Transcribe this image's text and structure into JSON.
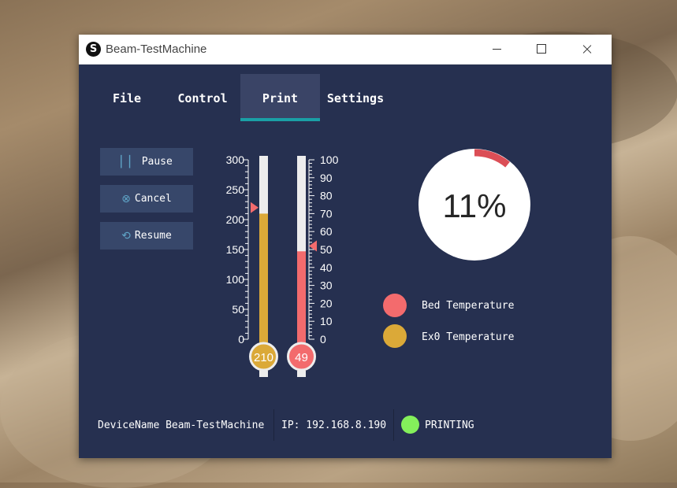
{
  "window": {
    "title": "Beam-TestMachine",
    "logo_glyph": "S"
  },
  "tabs": [
    {
      "label": "File",
      "active": false
    },
    {
      "label": "Control",
      "active": false
    },
    {
      "label": "Print",
      "active": true
    },
    {
      "label": "Settings",
      "active": false
    }
  ],
  "controls": [
    {
      "label": "Pause",
      "icon": "pause-icon"
    },
    {
      "label": "Cancel",
      "icon": "cancel-icon"
    },
    {
      "label": "Resume",
      "icon": "resume-icon"
    }
  ],
  "thermometers": [
    {
      "name": "ex0-temperature",
      "min": 0,
      "max": 300,
      "ticks": [
        "0",
        "50",
        "100",
        "150",
        "200",
        "250",
        "300"
      ],
      "fill_value": 210,
      "target_value": 220,
      "reading": "210",
      "color": "#dba938"
    },
    {
      "name": "bed-temperature",
      "min": 0,
      "max": 100,
      "ticks": [
        "0",
        "10",
        "20",
        "30",
        "40",
        "50",
        "60",
        "70",
        "80",
        "90",
        "100"
      ],
      "fill_value": 49,
      "target_value": 52,
      "reading": "49",
      "color": "#f36b6d"
    }
  ],
  "progress": {
    "label": "11%",
    "fraction": 0.11,
    "color": "#db4e56"
  },
  "legend": [
    {
      "label": "Bed Temperature",
      "color": "#f36b6d"
    },
    {
      "label": "Ex0 Temperature",
      "color": "#dba938"
    }
  ],
  "status": {
    "device": "DeviceName Beam-TestMachine",
    "ip": "IP: 192.168.8.190",
    "state": "PRINTING",
    "state_color": "#84ef5b"
  },
  "colors": {
    "window_bg": "#263050",
    "tab_active_bg": "#3a4466",
    "tab_indicator": "#1aa0a6",
    "button_bg": "#37476a",
    "marker": "#f36b6d"
  }
}
